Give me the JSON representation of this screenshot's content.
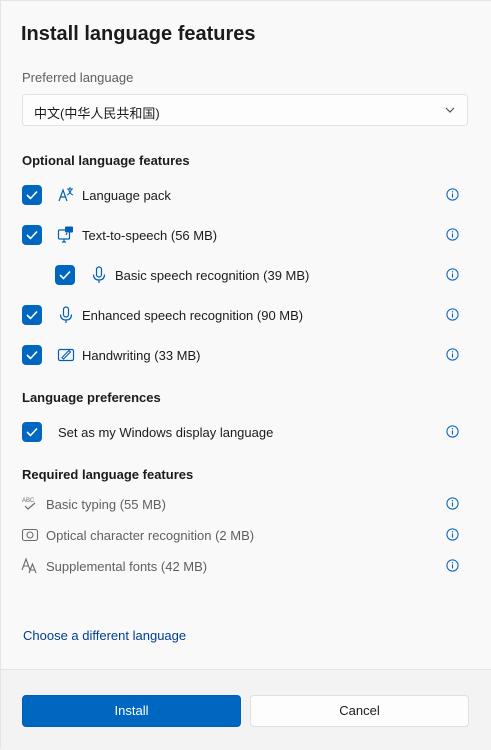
{
  "dialog": {
    "title": "Install language features",
    "preferred_language": {
      "label": "Preferred language",
      "value": "中文(中华人民共和国)"
    },
    "optional": {
      "heading": "Optional language features",
      "items": [
        {
          "label": "Language pack",
          "checked": true,
          "icon": "language-pack-icon"
        },
        {
          "label": "Text-to-speech (56 MB)",
          "checked": true,
          "icon": "text-to-speech-icon"
        },
        {
          "label": "Basic speech recognition (39 MB)",
          "checked": true,
          "icon": "microphone-icon"
        },
        {
          "label": "Enhanced speech recognition (90 MB)",
          "checked": true,
          "icon": "microphone-icon"
        },
        {
          "label": "Handwriting (33 MB)",
          "checked": true,
          "icon": "handwriting-icon"
        }
      ]
    },
    "preferences": {
      "heading": "Language preferences",
      "items": [
        {
          "label": "Set as my Windows display language",
          "checked": true
        }
      ]
    },
    "required": {
      "heading": "Required language features",
      "items": [
        {
          "label": "Basic typing (55 MB)",
          "icon": "basic-typing-icon"
        },
        {
          "label": "Optical character recognition (2 MB)",
          "icon": "ocr-camera-icon"
        },
        {
          "label": "Supplemental fonts (42 MB)",
          "icon": "fonts-icon"
        }
      ]
    },
    "choose_link": "Choose a different language",
    "buttons": {
      "install": "Install",
      "cancel": "Cancel"
    },
    "colors": {
      "accent": "#0067c0",
      "link": "#003e92",
      "icon_blue": "#005fb8"
    }
  }
}
